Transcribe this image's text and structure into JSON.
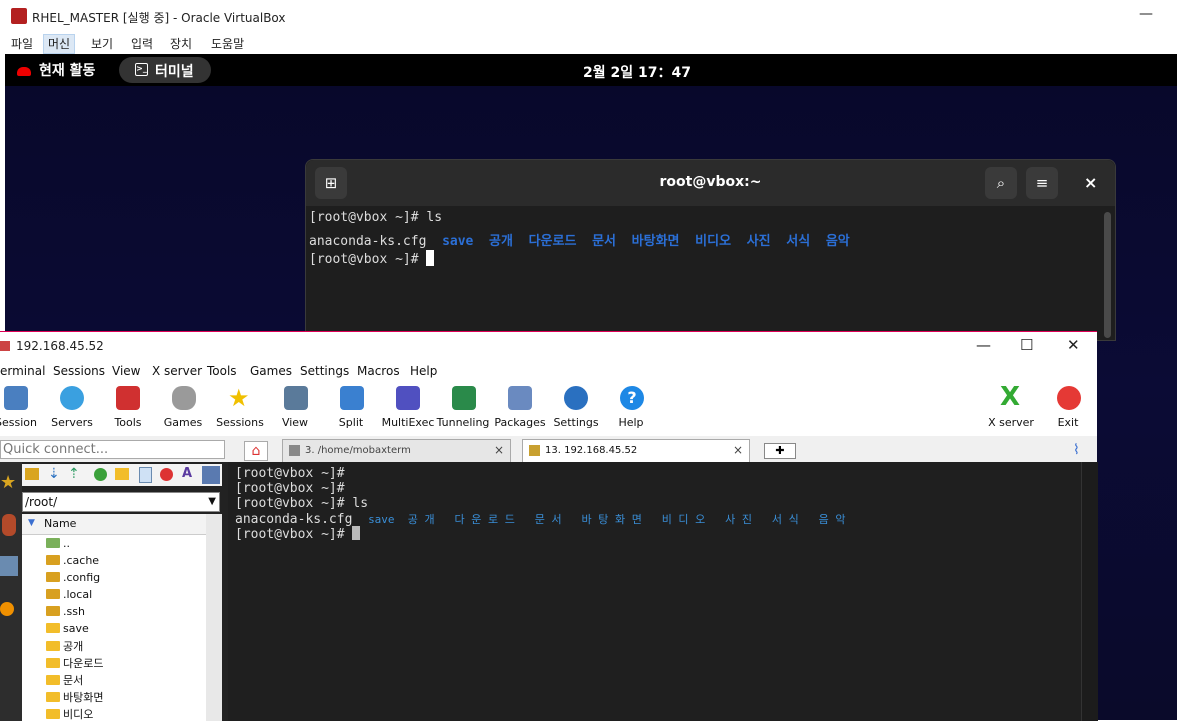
{
  "virtualbox": {
    "title": "RHEL_MASTER [실행 중] - Oracle VirtualBox",
    "minimize": "—",
    "menu": [
      "파일",
      "머신",
      "보기",
      "입력",
      "장치",
      "도움말"
    ],
    "selected_menu": "머신"
  },
  "gnome": {
    "activities": "현재 활동",
    "terminal_pill": "터미널",
    "clock": "2월 2일 17：47"
  },
  "gnome_terminal": {
    "title": "root@vbox:~",
    "new_tab_icon": "⊞",
    "search_icon": "⌕",
    "menu_icon": "≡",
    "close_icon": "×",
    "lines": {
      "l1": "[root@vbox ~]# ls",
      "l2_file": "anaconda-ks.cfg",
      "l2_dirs": "save  공개  다운로드  문서  바탕화면  비디오  사진  서식  음악",
      "l3": "[root@vbox ~]# "
    },
    "dir_color": "#2b6fd6"
  },
  "mobaxterm": {
    "title": "192.168.45.52",
    "window_controls": {
      "minimize": "—",
      "maximize": "☐",
      "close": "✕"
    },
    "menu": [
      "erminal",
      "Sessions",
      "View",
      "X server",
      "Tools",
      "Games",
      "Settings",
      "Macros",
      "Help"
    ],
    "toolbar": [
      "Session",
      "Servers",
      "Tools",
      "Games",
      "Sessions",
      "View",
      "Split",
      "MultiExec",
      "Tunneling",
      "Packages",
      "Settings",
      "Help"
    ],
    "toolbar_right": [
      "X server",
      "Exit"
    ],
    "quick_connect_placeholder": "Quick connect...",
    "tabs": [
      {
        "label": "3. /home/mobaxterm",
        "close": "×"
      },
      {
        "label": "13. 192.168.45.52",
        "close": "×"
      }
    ],
    "new_tab": "✚",
    "sftp": {
      "path": "/root/",
      "name_header": "Name",
      "files": [
        "..",
        ".cache",
        ".config",
        ".local",
        ".ssh",
        "save",
        "공개",
        "다운로드",
        "문서",
        "바탕화면",
        "비디오"
      ]
    },
    "terminal": {
      "l1": "[root@vbox ~]#",
      "l2": "[root@vbox ~]#",
      "l3": "[root@vbox ~]# ls",
      "l4_file": "anaconda-ks.cfg",
      "l4_dirs": "save  공 개   다 운 로 드   문 서   바 탕 화 면   비 디 오   사 진   서 식   음 악",
      "l5": "[root@vbox ~]# "
    },
    "dir_color": "#3a8fd8"
  }
}
